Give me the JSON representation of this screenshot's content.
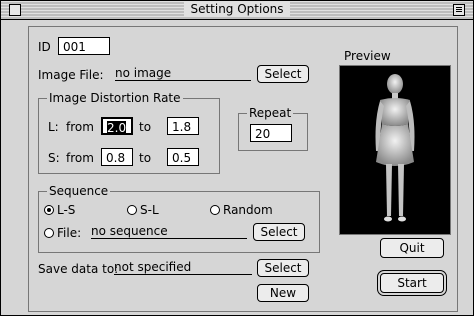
{
  "window": {
    "title": "Setting Options"
  },
  "form": {
    "id_label": "ID",
    "id_value": "001",
    "image_file_label": "Image File:",
    "image_file_value": "no image",
    "image_file_button": "Select",
    "distortion": {
      "title": "Image Distortion Rate",
      "l_label": "L:",
      "s_label": "S:",
      "from_label": "from",
      "to_label": "to",
      "l_from": "2.0",
      "l_to": "1.8",
      "s_from": "0.8",
      "s_to": "0.5"
    },
    "repeat": {
      "title": "Repeat",
      "value": "20"
    },
    "sequence": {
      "title": "Sequence",
      "options": [
        "L-S",
        "S-L",
        "Random"
      ],
      "selected": "L-S",
      "file_label": "File:",
      "file_value": "no sequence",
      "file_button": "Select"
    },
    "save": {
      "label": "Save data to:",
      "value": "not specified",
      "button": "Select"
    },
    "new_button": "New"
  },
  "preview": {
    "title": "Preview"
  },
  "actions": {
    "quit": "Quit",
    "start": "Start"
  }
}
